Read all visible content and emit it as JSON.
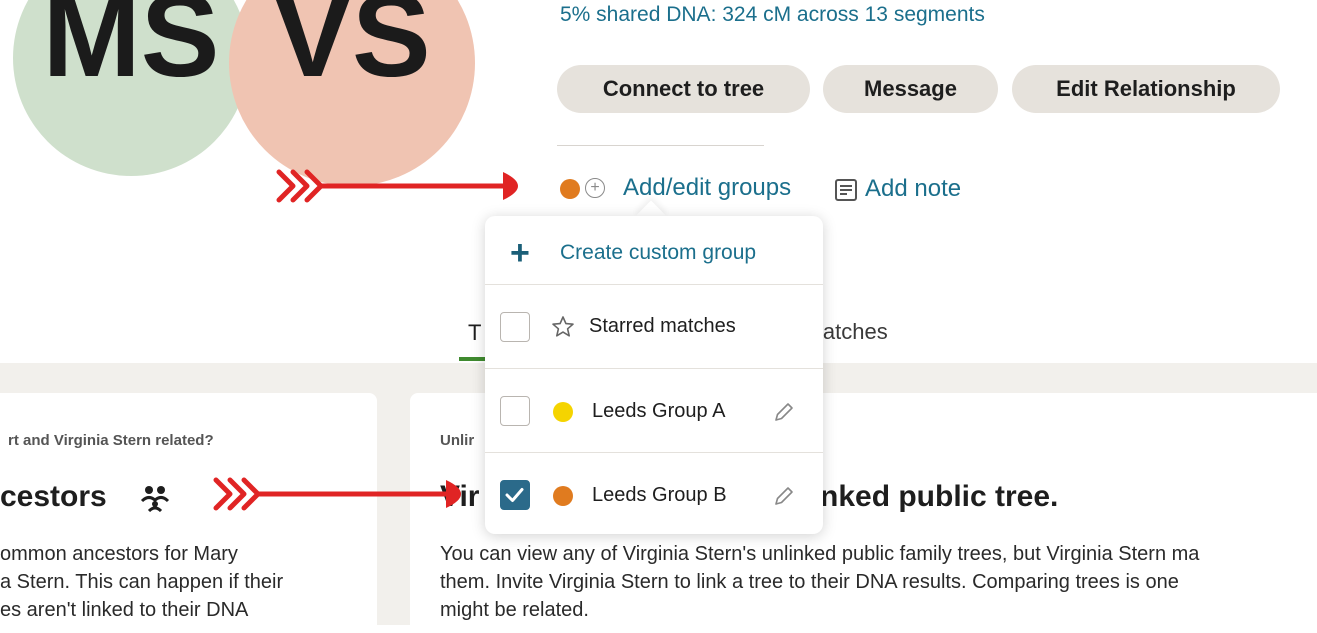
{
  "avatars": {
    "match_initials": "MS",
    "self_initials": "VS"
  },
  "shared_dna": "5% shared DNA: 324 cM across 13 segments",
  "actions": {
    "connect": "Connect to tree",
    "message": "Message",
    "edit_relationship": "Edit Relationship"
  },
  "groups_row": {
    "add_edit": "Add/edit groups",
    "add_note": "Add note"
  },
  "dropdown": {
    "create_label": "Create custom group",
    "items": [
      {
        "label": "Starred matches",
        "checked": false,
        "icon": "star-icon"
      },
      {
        "label": "Leeds Group A",
        "checked": false,
        "dot_color": "#f5d400",
        "editable": true
      },
      {
        "label": "Leeds Group B",
        "checked": true,
        "dot_color": "#e07b1f",
        "editable": true
      }
    ]
  },
  "tabs": {
    "partial_left": "T",
    "partial_right": "latches"
  },
  "left_card": {
    "question": "rt and Virginia Stern related?",
    "heading": "cestors",
    "body": "ommon ancestors for Mary\na Stern. This can happen if their\nes aren't linked to their DNA"
  },
  "right_card": {
    "label": "Unlir",
    "heading_a": "Vir",
    "heading_b": "nked public tree.",
    "body": "You can view any of Virginia Stern's unlinked public family trees, but Virginia Stern ma\nthem. Invite Virginia Stern to link a tree to their DNA results. Comparing trees is one\nmight be related."
  },
  "colors": {
    "link": "#1b6f8c",
    "arrow": "#e02424",
    "group_b": "#e07b1f",
    "group_a": "#f5d400",
    "checked": "#2b6a8a"
  }
}
